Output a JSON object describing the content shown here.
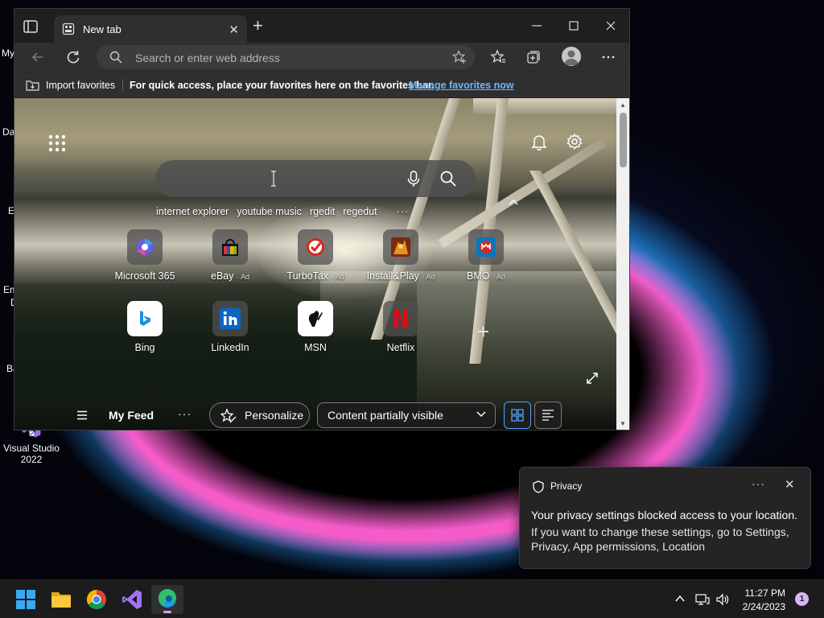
{
  "desktop": {
    "icons": [
      {
        "label": "Visual Studio 2022"
      }
    ],
    "fragments": [
      "My",
      "Da",
      "E",
      "Em",
      "D",
      "Ba"
    ]
  },
  "browser": {
    "tab": {
      "title": "New tab"
    },
    "address": {
      "placeholder": "Search or enter web address"
    },
    "favorites_bar": {
      "import_label": "Import favorites",
      "hint": "For quick access, place your favorites here on the favorites bar.",
      "manage_link": "Manage favorites now"
    },
    "newtab": {
      "search_suggestions": [
        "internet explorer",
        "youtube music",
        "rgedit",
        "regedut"
      ],
      "more_label": "···",
      "tiles": [
        {
          "label": "Microsoft 365",
          "ad": "",
          "icon": "microsoft-365-icon"
        },
        {
          "label": "eBay",
          "ad": "· Ad",
          "icon": "ebay-icon"
        },
        {
          "label": "TurboTax",
          "ad": "· Ad",
          "icon": "turbotax-icon"
        },
        {
          "label": "Install&Play",
          "ad": "· Ad",
          "icon": "install-play-icon"
        },
        {
          "label": "BMO",
          "ad": "· Ad",
          "icon": "bmo-icon"
        },
        {
          "label": "Bing",
          "ad": "",
          "icon": "bing-icon"
        },
        {
          "label": "LinkedIn",
          "ad": "",
          "icon": "linkedin-icon"
        },
        {
          "label": "MSN",
          "ad": "",
          "icon": "msn-icon"
        },
        {
          "label": "Netflix",
          "ad": "",
          "icon": "netflix-icon"
        }
      ],
      "feed": {
        "title": "My Feed",
        "more": "···",
        "personalize": "Personalize",
        "content_select": "Content partially visible"
      }
    }
  },
  "toast": {
    "app": "Privacy",
    "more": "···",
    "heading": "Your privacy settings blocked access to your location.",
    "body": "If you want to change these settings, go to Settings, Privacy, App permissions, Location"
  },
  "taskbar": {
    "time": "11:27 PM",
    "date": "2/24/2023",
    "notification_count": "1"
  },
  "colors": {
    "accent_link": "#6db7ff",
    "taskbar_bg": "#1c1c1c",
    "window_bg": "#202020"
  }
}
